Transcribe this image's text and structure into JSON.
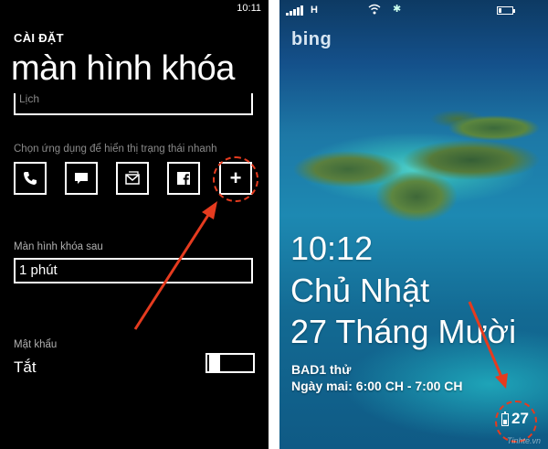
{
  "settings_screen": {
    "clock": "10:11",
    "section_label": "CÀI ĐẶT",
    "title": "màn hình khóa",
    "notification_partial_value": "Lịch",
    "quick_status_label": "Chọn ứng dụng để hiển thị trạng thái nhanh",
    "quick_status_apps": [
      "phone-icon",
      "messaging-icon",
      "mail-icon",
      "facebook-icon",
      "add-icon"
    ],
    "add_symbol": "+",
    "lock_after_label": "Màn hình khóa sau",
    "lock_after_value": "1 phút",
    "password_label": "Mật khẩu",
    "password_value": "Tắt",
    "password_toggle_on": false
  },
  "lock_screen": {
    "network": "H",
    "bing_logo": "bing",
    "time": "10:12",
    "day": "Chủ Nhật",
    "date": "27 Tháng Mười",
    "event_title": "BAD1 thử",
    "event_detail": "Ngày mai: 6:00 CH - 7:00 CH",
    "badge_count": "27",
    "watermark": "Tinhte.vn"
  },
  "colors": {
    "annotation": "#e53b1f",
    "settings_bg": "#000000",
    "secondary_text": "#8a8a8a"
  }
}
